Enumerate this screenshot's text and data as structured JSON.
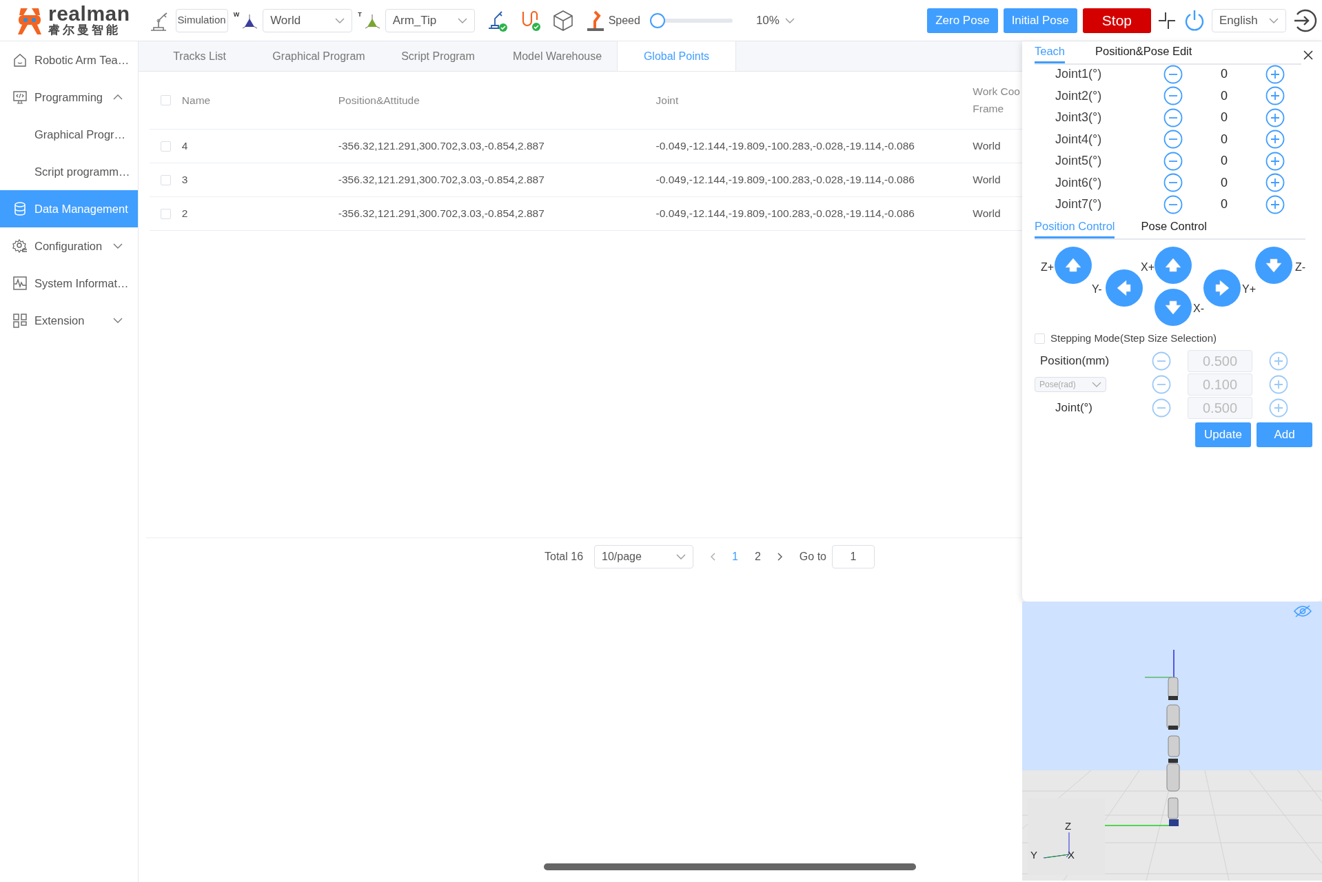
{
  "header": {
    "logo": {
      "name": "realman",
      "subtitle": "睿尔曼智能"
    },
    "mode_button": "Simulation",
    "frame_select": {
      "badge": "W",
      "value": "World"
    },
    "tool_select": {
      "badge": "T",
      "value": "Arm_Tip"
    },
    "speed": {
      "label": "Speed",
      "level": 0,
      "reading": "10%"
    },
    "buttons": [
      {
        "label": "Zero Pose",
        "kind": "primary"
      },
      {
        "label": "Initial Pose",
        "kind": "primary"
      },
      {
        "label": "Stop",
        "kind": "danger"
      }
    ],
    "language": "English"
  },
  "sidebar": {
    "items": [
      {
        "label": "Robotic Arm Tea…",
        "selected": false
      },
      {
        "label": "Programming",
        "selected": false,
        "expanded": true,
        "children": [
          {
            "label": "Graphical Progr…",
            "selected": false
          },
          {
            "label": "Script programm…",
            "selected": false
          }
        ]
      },
      {
        "label": "Data Management",
        "selected": true
      },
      {
        "label": "Configuration",
        "selected": false,
        "expanded": false
      },
      {
        "label": "System Informat…",
        "selected": false
      },
      {
        "label": "Extension",
        "selected": false,
        "expanded": false
      }
    ]
  },
  "tabs": [
    {
      "label": "Tracks List",
      "selected": false
    },
    {
      "label": "Graphical Program",
      "selected": false
    },
    {
      "label": "Script Program",
      "selected": false
    },
    {
      "label": "Model Warehouse",
      "selected": false
    },
    {
      "label": "Global Points",
      "selected": true
    }
  ],
  "table": {
    "select_all": {
      "checked": false
    },
    "columns": [
      "Name",
      "Position&Attitude",
      "Joint",
      "Work Coo Frame"
    ],
    "rows": [
      {
        "checked": false,
        "cells": [
          "4",
          "-356.32,121.291,300.702,3.03,-0.854,2.887",
          "-0.049,-12.144,-19.809,-100.283,-0.028,-19.114,-0.086",
          "World"
        ]
      },
      {
        "checked": false,
        "cells": [
          "3",
          "-356.32,121.291,300.702,3.03,-0.854,2.887",
          "-0.049,-12.144,-19.809,-100.283,-0.028,-19.114,-0.086",
          "World"
        ]
      },
      {
        "checked": false,
        "cells": [
          "2",
          "-356.32,121.291,300.702,3.03,-0.854,2.887",
          "-0.049,-12.144,-19.809,-100.283,-0.028,-19.114,-0.086",
          "World"
        ]
      }
    ]
  },
  "pagination": {
    "total": "Total 16",
    "page_size": "10/page",
    "pages": [
      {
        "label": "1",
        "selected": true
      },
      {
        "label": "2",
        "selected": false
      }
    ],
    "goto_label": "Go to",
    "goto_value": "1"
  },
  "panel": {
    "tabs": [
      {
        "label": "Teach",
        "selected": true
      },
      {
        "label": "Position&Pose Edit",
        "selected": false
      }
    ],
    "joints": [
      {
        "label": "Joint1(°)",
        "value": "0"
      },
      {
        "label": "Joint2(°)",
        "value": "0"
      },
      {
        "label": "Joint3(°)",
        "value": "0"
      },
      {
        "label": "Joint4(°)",
        "value": "0"
      },
      {
        "label": "Joint5(°)",
        "value": "0"
      },
      {
        "label": "Joint6(°)",
        "value": "0"
      },
      {
        "label": "Joint7(°)",
        "value": "0"
      }
    ],
    "control_tabs": [
      {
        "label": "Position Control",
        "selected": true
      },
      {
        "label": "Pose Control",
        "selected": false
      }
    ],
    "jog": [
      {
        "label": "Z+"
      },
      {
        "label": "Y-"
      },
      {
        "label": "X+"
      },
      {
        "label": "X-"
      },
      {
        "label": "Y+"
      },
      {
        "label": "Z-"
      }
    ],
    "stepping": {
      "label": "Stepping Mode(Step Size Selection)",
      "checked": false
    },
    "steps": [
      {
        "kind": "label",
        "label": "Position(mm)",
        "value": "0.500"
      },
      {
        "kind": "select",
        "label": "Pose(rad)",
        "value": "0.100"
      },
      {
        "kind": "label",
        "label": "Joint(°)",
        "value": "0.500"
      }
    ],
    "actions": [
      "Update",
      "Add"
    ]
  },
  "view": {
    "axes": [
      "Z",
      "Y",
      "X"
    ]
  }
}
